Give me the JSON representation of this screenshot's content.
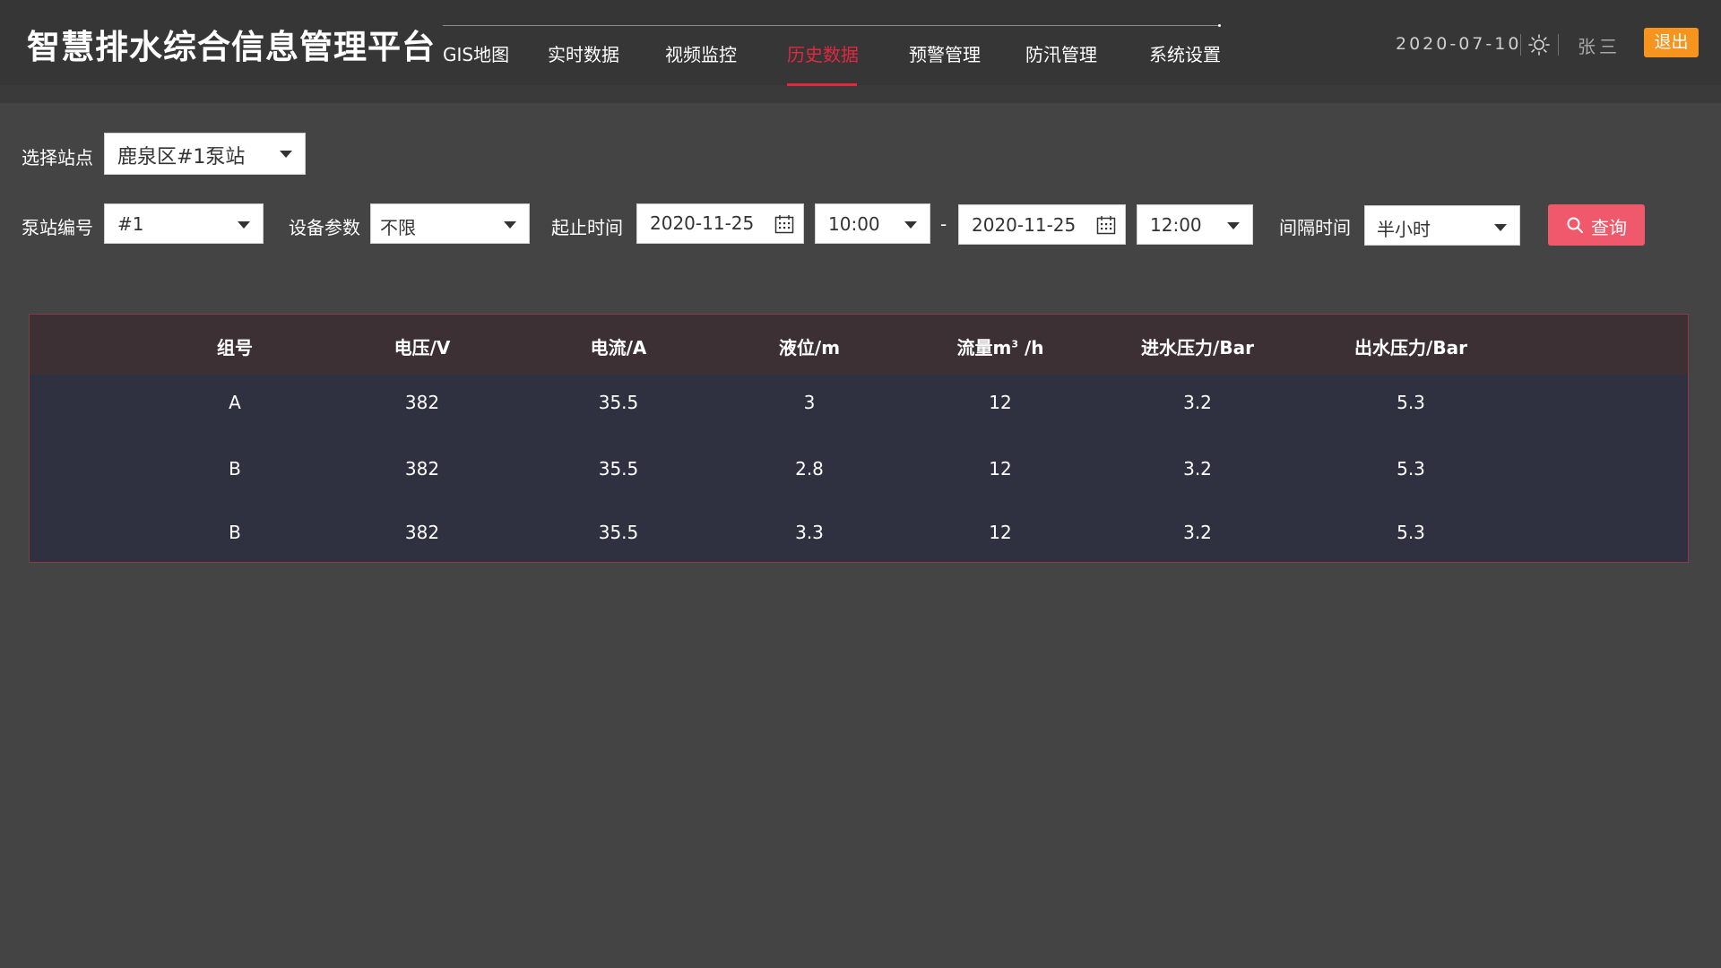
{
  "header": {
    "app_title": "智慧排水综合信息管理平台",
    "nav": [
      {
        "label": "GIS地图",
        "active": false
      },
      {
        "label": "实时数据",
        "active": false
      },
      {
        "label": "视频监控",
        "active": false
      },
      {
        "label": "历史数据",
        "active": true
      },
      {
        "label": "预警管理",
        "active": false
      },
      {
        "label": "防汛管理",
        "active": false
      },
      {
        "label": "系统设置",
        "active": false
      }
    ],
    "date": "2020-07-10",
    "user": "张三",
    "logout": "退出"
  },
  "filters": {
    "station_label": "选择站点",
    "station_value": "鹿泉区#1泵站",
    "pump_label": "泵站编号",
    "pump_value": "#1",
    "param_label": "设备参数",
    "param_value": "不限",
    "time_label": "起止时间",
    "start_date": "2020-11-25",
    "start_time": "10:00",
    "range_sep": "-",
    "end_date": "2020-11-25",
    "end_time": "12:00",
    "interval_label": "间隔时间",
    "interval_value": "半小时",
    "query_label": "查询"
  },
  "table": {
    "columns": [
      "组号",
      "电压/V",
      "电流/A",
      "液位/m",
      "流量m",
      "进水压力/Bar",
      "出水压力/Bar"
    ],
    "flow_sup": "3",
    "flow_suffix": " /h",
    "rows": [
      [
        "A",
        "382",
        "35.5",
        "3",
        "12",
        "3.2",
        "5.3"
      ],
      [
        "B",
        "382",
        "35.5",
        "2.8",
        "12",
        "3.2",
        "5.3"
      ],
      [
        "B",
        "382",
        "35.5",
        "3.3",
        "12",
        "3.2",
        "5.3"
      ]
    ]
  },
  "colors": {
    "accent": "#e0293f",
    "logout": "#f7941d",
    "query": "#f0596b"
  }
}
